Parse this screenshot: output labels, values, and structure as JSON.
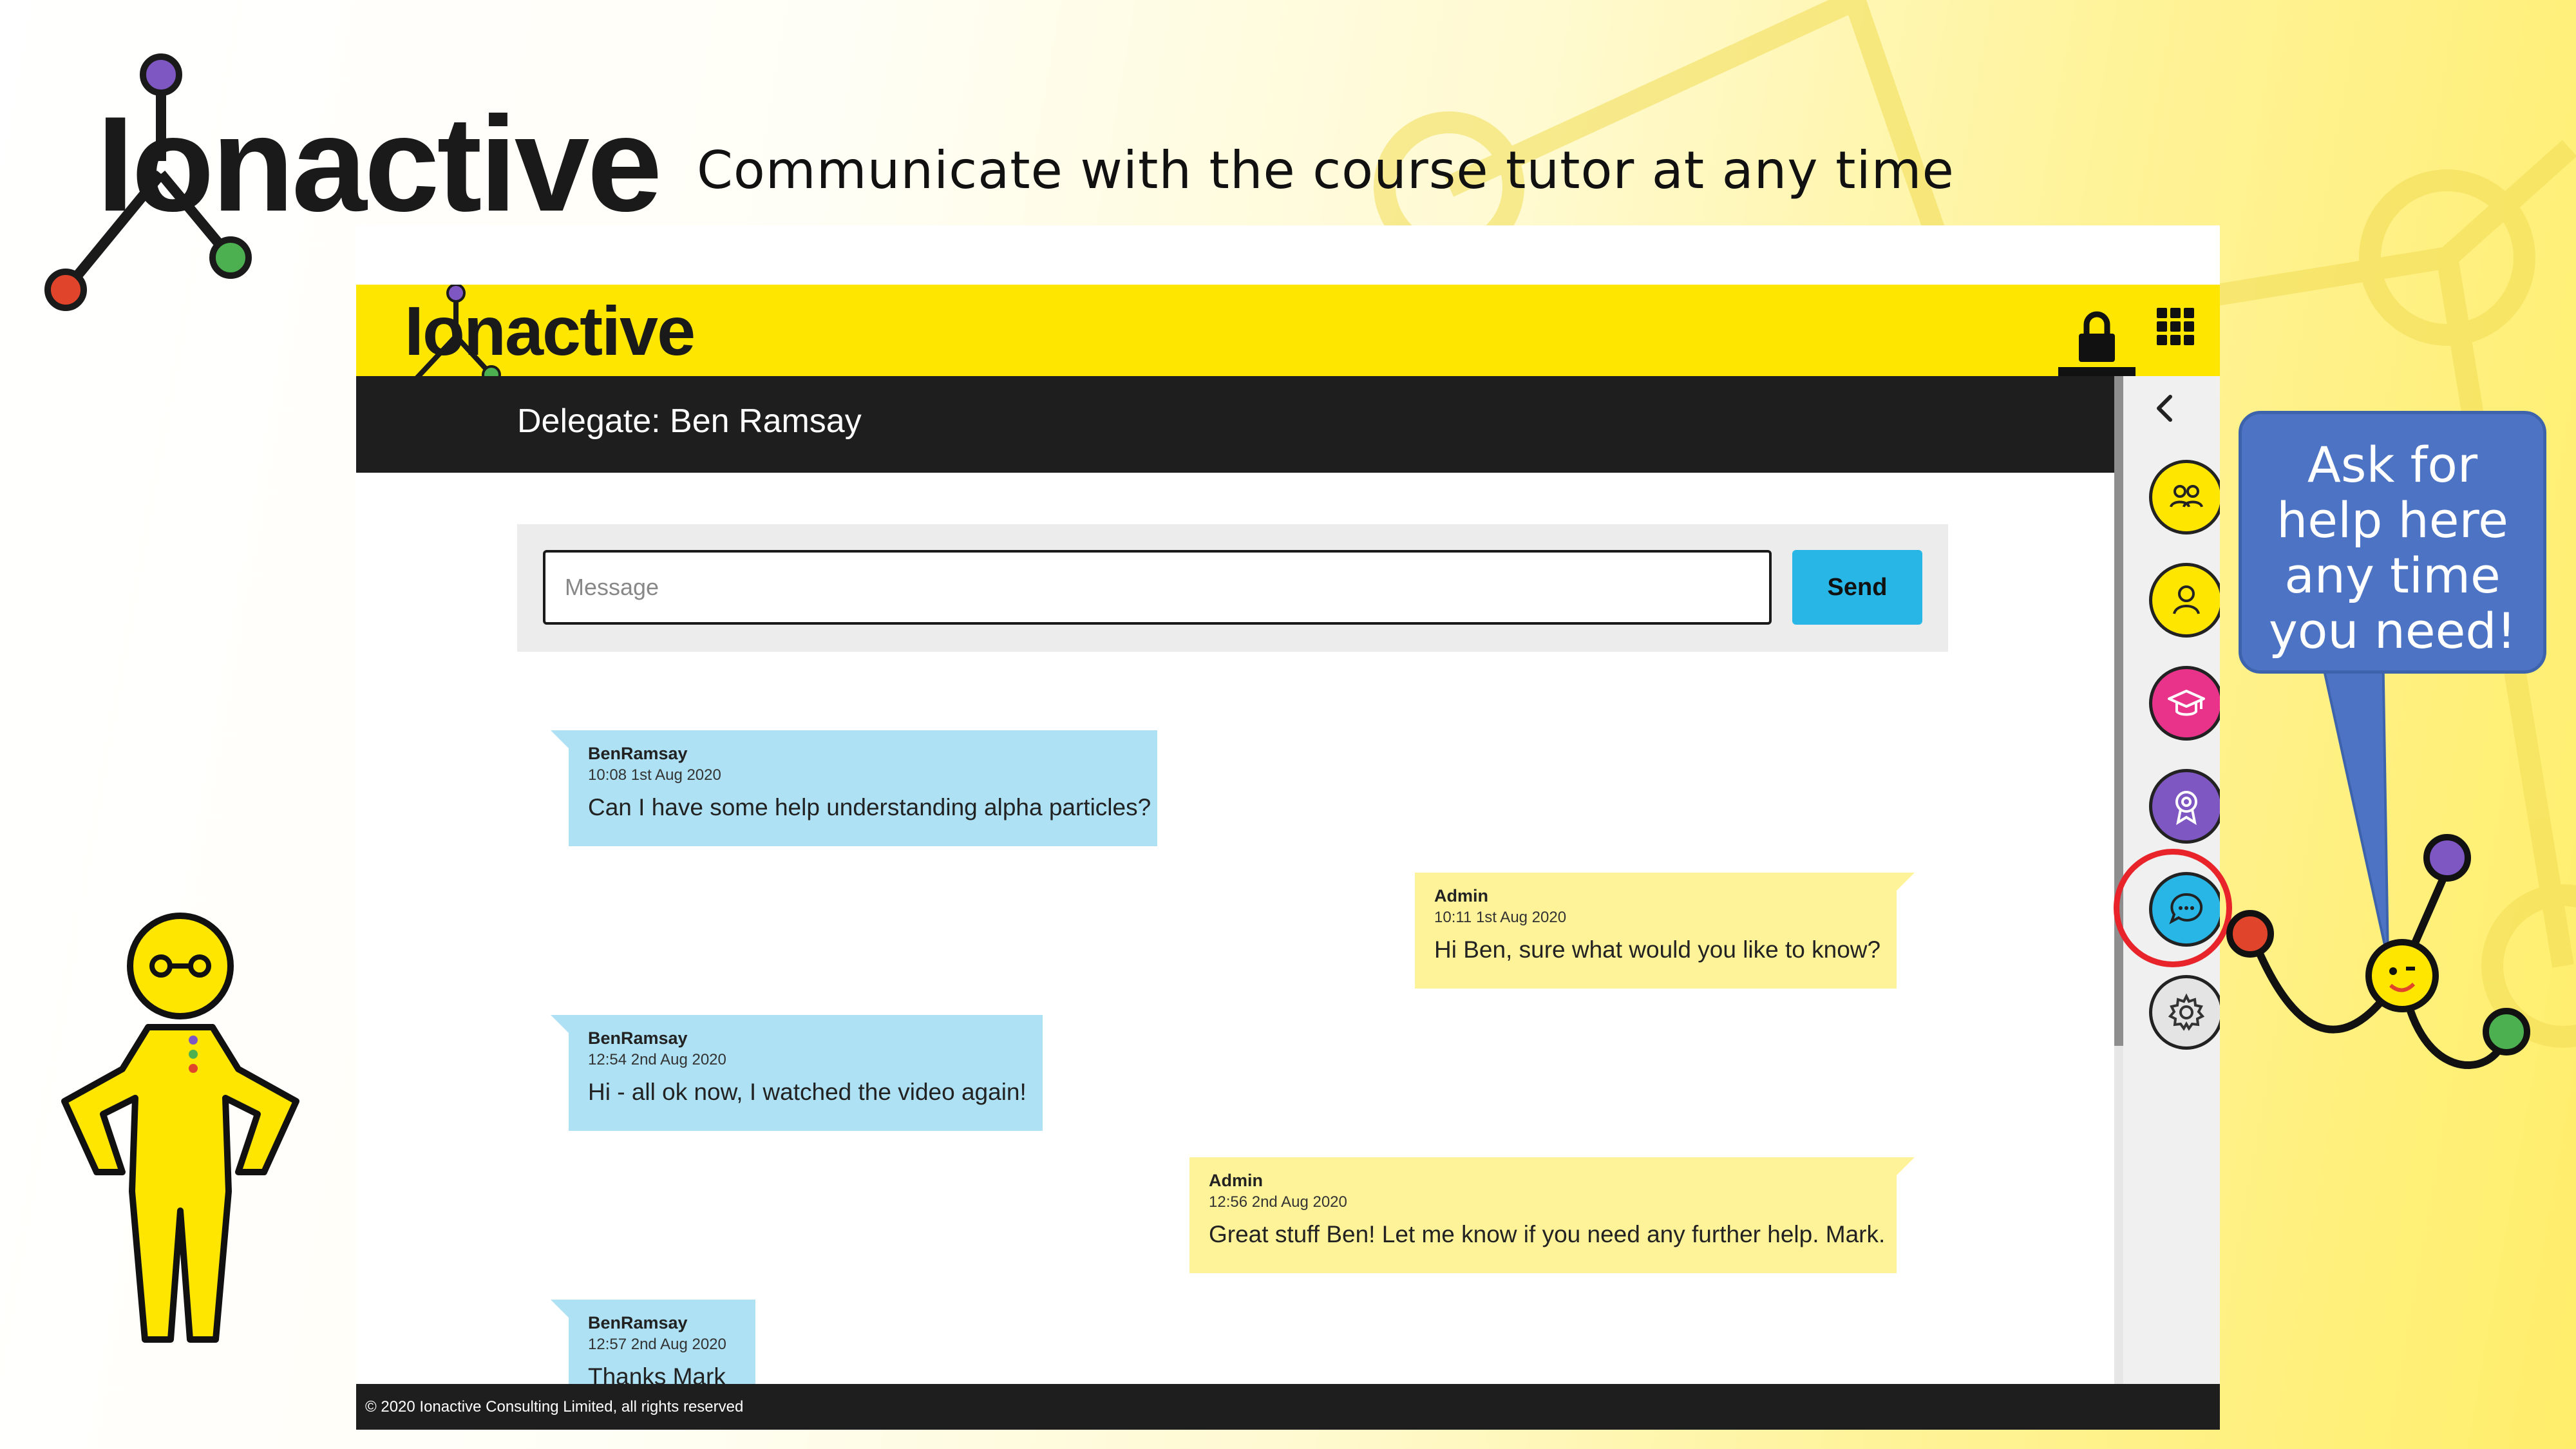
{
  "slide": {
    "logo_text": "Ionactive",
    "headline": "Communicate with the course tutor at any time",
    "callout": [
      "Ask for",
      "help here",
      "any time",
      "you need!"
    ]
  },
  "app": {
    "logo_text": "Ionactive",
    "header_icons": [
      "lock-icon",
      "grid-menu-icon"
    ],
    "delegate_label": "Delegate: Ben Ramsay",
    "compose": {
      "placeholder": "Message",
      "send_label": "Send"
    },
    "messages": [
      {
        "author": "BenRamsay",
        "time": "10:08 1st Aug 2020",
        "text": "Can I have some help understanding alpha particles?",
        "side": "user"
      },
      {
        "author": "Admin",
        "time": "10:11 1st Aug 2020",
        "text": "Hi Ben, sure what would you like to know?",
        "side": "admin"
      },
      {
        "author": "BenRamsay",
        "time": "12:54 2nd Aug 2020",
        "text": "Hi - all ok now, I watched the video again!",
        "side": "user"
      },
      {
        "author": "Admin",
        "time": "12:56 2nd Aug 2020",
        "text": "Great stuff Ben! Let me know if you need any further help. Mark.",
        "side": "admin"
      },
      {
        "author": "BenRamsay",
        "time": "12:57 2nd Aug 2020",
        "text": "Thanks Mark",
        "side": "user"
      }
    ],
    "footer": "© 2020 Ionactive Consulting Limited, all rights reserved",
    "sidebar": {
      "collapse_icon": "chevron-left-icon",
      "items": [
        {
          "icon": "group-icon",
          "color": "#ffe600"
        },
        {
          "icon": "user-icon",
          "color": "#ffe600"
        },
        {
          "icon": "graduation-cap-icon",
          "color": "#e9338a"
        },
        {
          "icon": "award-icon",
          "color": "#7e57c2"
        },
        {
          "icon": "chat-icon",
          "color": "#28b6e6",
          "highlighted": true
        },
        {
          "icon": "gear-icon",
          "color": "#e4e4e4"
        }
      ]
    }
  },
  "colors": {
    "brand_yellow": "#ffe600",
    "header_dark": "#1e1e1e",
    "send_blue": "#28b6e6",
    "user_bubble": "#aee1f3",
    "admin_bubble": "#fff39a",
    "callout_blue": "#4d74c4",
    "highlight_red": "#e8232a"
  }
}
